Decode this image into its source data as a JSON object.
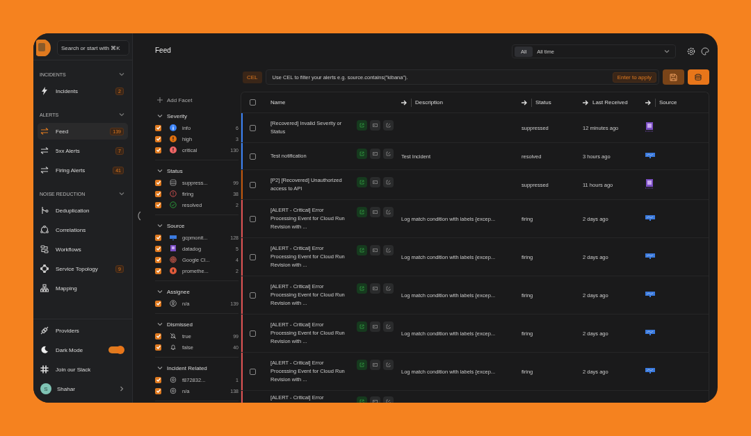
{
  "sidebar": {
    "search": {
      "placeholder": "Search or start with ⌘K"
    },
    "sections": [
      {
        "title": "INCIDENTS",
        "expanded": true,
        "items": [
          {
            "kind": "bolt",
            "label": "Incidents",
            "badge": "2",
            "selected": false
          }
        ]
      },
      {
        "title": "ALERTS",
        "expanded": true,
        "items": [
          {
            "kind": "swap",
            "label": "Feed",
            "badge": "139",
            "selected": true
          },
          {
            "kind": "swap",
            "label": "5xx Alerts",
            "badge": "7",
            "selected": false
          },
          {
            "kind": "swap",
            "label": "Firing Alerts",
            "badge": "41",
            "selected": false
          }
        ]
      },
      {
        "title": "NOISE REDUCTION",
        "expanded": true,
        "items": [
          {
            "kind": "dedup",
            "label": "Deduplication",
            "selected": false
          },
          {
            "kind": "correl",
            "label": "Correlations",
            "selected": false
          },
          {
            "kind": "flow",
            "label": "Workflows",
            "selected": false
          },
          {
            "kind": "topo",
            "label": "Service Topology",
            "badge": "9",
            "selected": false
          },
          {
            "kind": "map",
            "label": "Mapping",
            "selected": false
          }
        ]
      }
    ],
    "footer": [
      {
        "kind": "plug",
        "label": "Providers"
      },
      {
        "kind": "moon",
        "label": "Dark Mode",
        "toggle": true
      },
      {
        "kind": "slack",
        "label": "Join our Slack"
      }
    ],
    "user": {
      "initial": "S",
      "name": "Shahar"
    }
  },
  "header": {
    "title": "Feed",
    "time_scope": "All",
    "time_range": "All time"
  },
  "cel": {
    "badge": "CEL",
    "placeholder": "Use CEL to filter your alerts e.g. source.contains(\"kibana\").",
    "apply": "Enter to apply"
  },
  "facets": {
    "add": "Add Facet",
    "groups": [
      {
        "title": "Severity",
        "options": [
          {
            "kind": "info",
            "label": "info",
            "count": "6",
            "checked": true
          },
          {
            "kind": "high",
            "label": "high",
            "count": "3",
            "checked": true
          },
          {
            "kind": "critical",
            "label": "critical",
            "count": "130",
            "checked": true
          }
        ]
      },
      {
        "title": "Status",
        "options": [
          {
            "kind": "suppressed",
            "label": "suppress...",
            "count": "99",
            "checked": true
          },
          {
            "kind": "firing",
            "label": "firing",
            "count": "38",
            "checked": true
          },
          {
            "kind": "resolved",
            "label": "resolved",
            "count": "2",
            "checked": true
          }
        ]
      },
      {
        "title": "Source",
        "options": [
          {
            "kind": "gcp",
            "label": "gcpmonit...",
            "count": "128",
            "checked": true
          },
          {
            "kind": "datadog",
            "label": "datadog",
            "count": "5",
            "checked": true
          },
          {
            "kind": "gcloud",
            "label": "Google Cl...",
            "count": "4",
            "checked": true
          },
          {
            "kind": "prometheus",
            "label": "promethe...",
            "count": "2",
            "checked": true
          }
        ]
      },
      {
        "title": "Assignee",
        "options": [
          {
            "kind": "user",
            "label": "n/a",
            "count": "139",
            "checked": true
          }
        ]
      },
      {
        "title": "Dismissed",
        "options": [
          {
            "kind": "belloff",
            "label": "true",
            "count": "99",
            "checked": true
          },
          {
            "kind": "bell",
            "label": "false",
            "count": "40",
            "checked": true
          }
        ]
      },
      {
        "title": "Incident Related",
        "options": [
          {
            "kind": "incident",
            "label": "f872832...",
            "count": "1",
            "checked": true
          },
          {
            "kind": "incident",
            "label": "n/a",
            "count": "138",
            "checked": true
          }
        ]
      }
    ]
  },
  "table": {
    "select_all": false,
    "columns": [
      {
        "label": "Name",
        "arrow": false
      },
      {
        "label": "Description",
        "arrow": true
      },
      {
        "label": "Status",
        "arrow": true
      },
      {
        "label": "Last Received",
        "arrow": true
      },
      {
        "label": "Source",
        "arrow": true
      }
    ],
    "rows": [
      {
        "color": "#3b82f6",
        "checked": false,
        "name": "[Recovered] Invalid Severity or Status",
        "description": "",
        "status": "suppressed",
        "last_received": "12 minutes ago",
        "source": {
          "kind": "datadog"
        }
      },
      {
        "color": "#3b82f6",
        "checked": false,
        "name": "Test notification",
        "description": "Test Incident",
        "status": "resolved",
        "last_received": "3 hours ago",
        "source": {
          "kind": "gcp"
        }
      },
      {
        "color": "#c2570c",
        "checked": false,
        "name": "[P2] [Recovered] Unauthorized access to API",
        "description": "",
        "status": "suppressed",
        "last_received": "11 hours ago",
        "source": {
          "kind": "datadog"
        }
      },
      {
        "color": "#e05252",
        "checked": false,
        "name": "[ALERT - Critical] Error Processing Event for Cloud Run Revision with ...",
        "description": "Log match condition with labels {excep...",
        "status": "firing",
        "last_received": "2 days ago",
        "source": {
          "kind": "gcp"
        }
      },
      {
        "color": "#e05252",
        "checked": false,
        "name": "[ALERT - Critical] Error Processing Event for Cloud Run Revision with ...",
        "description": "Log match condition with labels {excep...",
        "status": "firing",
        "last_received": "2 days ago",
        "source": {
          "kind": "gcp"
        }
      },
      {
        "color": "#e05252",
        "checked": false,
        "name": "[ALERT - Critical] Error Processing Event for Cloud Run Revision with ...",
        "description": "Log match condition with labels {excep...",
        "status": "firing",
        "last_received": "2 days ago",
        "source": {
          "kind": "gcp"
        }
      },
      {
        "color": "#e05252",
        "checked": false,
        "name": "[ALERT - Critical] Error Processing Event for Cloud Run Revision with ...",
        "description": "Log match condition with labels {excep...",
        "status": "firing",
        "last_received": "2 days ago",
        "source": {
          "kind": "gcp"
        }
      },
      {
        "color": "#e05252",
        "checked": false,
        "name": "[ALERT - Critical] Error Processing Event for Cloud Run Revision with ...",
        "description": "Log match condition with labels {excep...",
        "status": "firing",
        "last_received": "2 days ago",
        "source": {
          "kind": "gcp"
        }
      },
      {
        "color": "#e05252",
        "name": "[ALERT - Critical] Error",
        "description": "",
        "status": "",
        "last_received": ""
      }
    ]
  }
}
